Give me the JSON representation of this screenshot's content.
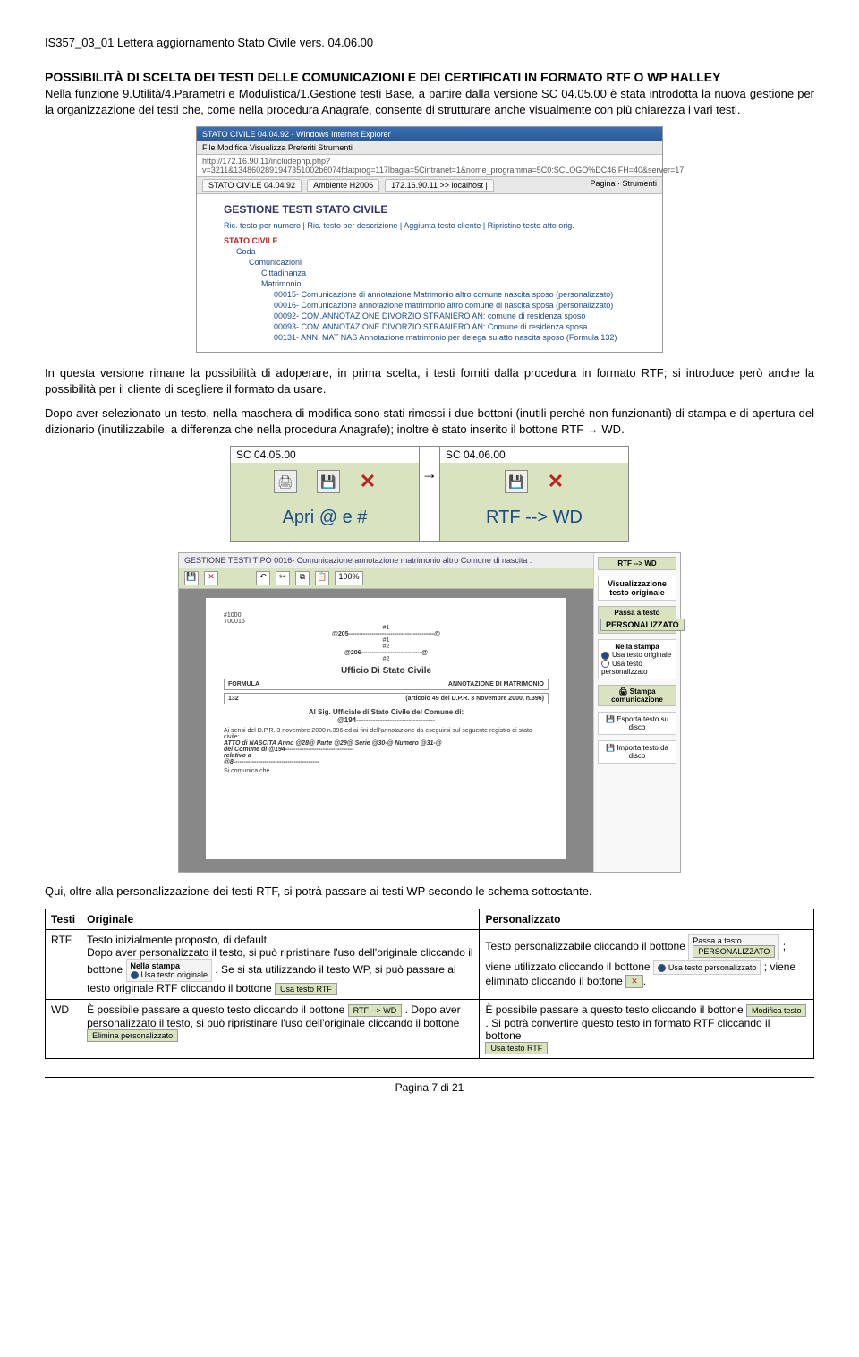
{
  "header": "IS357_03_01 Lettera aggiornamento Stato Civile vers. 04.06.00",
  "title_line1": "POSSIBILITÀ DI SCELTA DEI TESTI DELLE COMUNICAZIONI E DEI CERTIFICATI IN FORMATO RTF O WP HALLEY",
  "intro": "Nella funzione 9.Utilità/4.Parametri e Modulistica/1.Gestione testi Base, a partire dalla versione SC 04.05.00 è stata introdotta la nuova gestione per la organizzazione dei testi che, come nella procedura Anagrafe, consente di strutturare anche visualmente con più chiarezza i vari testi.",
  "ss1": {
    "title": "STATO CIVILE 04.04.92 - Windows Internet Explorer",
    "menu": "File   Modifica   Visualizza   Preferiti   Strumenti",
    "addr": "http://172.16.90.11/includephp.php?v=3211&1348602891947351002b6074fdatprog=117lbagia=5Cintranet=1&nome_programma=5C0:SCLOGO%DC46IFH=40&server=17",
    "tabs": [
      "STATO CIVILE 04.04.92",
      "Ambiente H2006",
      "172.16.90.11 >> localhost |"
    ],
    "tabright": "Pagina  ·  Strumenti",
    "heading": "GESTIONE TESTI STATO CIVILE",
    "links": "Ric. testo per numero | Ric. testo per descrizione | Aggiunta testo cliente | Ripristino testo atto orig.",
    "tree": {
      "root": "STATO CIVILE",
      "l1": "Coda",
      "l2_1": "Comunicazioni",
      "l3_1": "Cittadinanza",
      "l3_2": "Matrimonio",
      "l4_1": "00015- Comunicazione di annotazione Matrimonio altro comune nascita sposo (personalizzato)",
      "l4_2": "00016- Comunicazione annotazione matrimonio altro comune di nascita sposa (personalizzato)",
      "l4_3": "00092- COM.ANNOTAZIONE DIVORZIO STRANIERO AN: comune di residenza sposo",
      "l4_4": "00093- COM.ANNOTAZIONE DIVORZIO STRANIERO AN: Comune di residenza sposa",
      "l4_5": "00131- ANN. MAT NAS Annotazione matrimonio per delega su atto nascita sposo (Formula 132)"
    }
  },
  "para2": "In questa versione rimane la possibilità di adoperare, in prima scelta, i testi forniti dalla procedura in formato RTF; si introduce però anche la possibilità per il cliente di scegliere il formato da usare.",
  "para3": "Dopo aver selezionato un testo, nella maschera di modifica sono stati rimossi i due bottoni (inutili perché non funzionanti) di stampa e di apertura del dizionario (inutilizzabile, a differenza che nella procedura Anagrafe); inoltre è stato inserito il bottone RTF → WD.",
  "toolbar": {
    "head_left": "SC 04.05.00",
    "head_right": "SC 04.06.00",
    "arrow": "→",
    "label_left": "Apri @ e #",
    "label_right": "RTF --> WD"
  },
  "editor": {
    "title": "GESTIONE TESTI TIPO 0016- Comunicazione annotazione matrimonio altro Comune di nascita :",
    "zoom": "100%",
    "doc": {
      "l1": "#1000",
      "l2": "T00016",
      "l3": "#1",
      "l4": "@205-----------------------------------------@",
      "l5": "#1",
      "l6": "#2",
      "l7": "@206-----------------------------@",
      "l8": "#2",
      "heading": "Ufficio Di Stato Civile",
      "formula_label": "FORMULA",
      "formula_text": "ANNOTAZIONE DI MATRIMONIO",
      "num": "132",
      "num_text": "(articolo 49 del D.P.R. 3 Novembre 2000, n.396)",
      "dest": "Al Sig. Ufficiale di Stato Civile del Comune di:",
      "dest2": "@194---------------------------------",
      "body1": "Ai sensi del D.P.R. 3 novembre 2000 n.396 ed ai fini dell'annotazione da eseguirsi sul seguente registro di stato civile:",
      "body2": "ATTO di NASCITA Anno @28@ Parte @29@ Serie @30-@ Numero @31-@",
      "body3": "del Comune di @194---------------------------------",
      "body4": "relativo a",
      "body5": "@8-----------------------------------------",
      "body6": "Si comunica che"
    },
    "right": {
      "btn_rtf": "RTF --> WD",
      "vis_head": "Visualizzazione testo originale",
      "passa_head": "Passa a testo",
      "passa_btn": "PERSONALIZZATO",
      "stampa_head": "Nella stampa",
      "radio1": "Usa testo originale",
      "radio2": "Usa testo personalizzato",
      "stampa_btn": "Stampa comunicazione",
      "esporta": "Esporta testo su disco",
      "importa": "Importa testo da disco"
    }
  },
  "para4": "Qui, oltre alla personalizzazione dei testi RTF, si potrà passare ai testi WP secondo le schema sottostante.",
  "table": {
    "h1": "Testi",
    "h2": "Originale",
    "h3": "Personalizzato",
    "r1c1": "RTF",
    "r1c2_a": "Testo inizialmente proposto, di default.",
    "r1c2_b": "Dopo aver personalizzato il testo, si può ripristinare l'uso dell'originale cliccando il bottone ",
    "r1c2_c": ". Se si sta utilizzando il testo WP, si può passare al testo  originale RTF  cliccando il bottone ",
    "r1c3_a": "Testo personalizzabile cliccando il bottone ",
    "r1c3_b": "; viene utilizzato cliccando il bottone ",
    "r1c3_c": "; viene eliminato cliccando il bottone ",
    "r2c1": "WD",
    "r2c2_a": "È possibile passare a questo testo cliccando il bottone ",
    "r2c2_b": ". Dopo aver personalizzato il testo, si può ripristinare l'uso dell'originale cliccando il bottone",
    "r2c3_a": "È possibile passare a questo testo cliccando il bottone ",
    "r2c3_b": ". Si potrà convertire questo testo in formato RTF cliccando il bottone",
    "btns": {
      "nella_stampa_head": "Nella stampa",
      "usa_orig": "Usa testo originale",
      "usa_rtf": "Usa testo RTF",
      "passa_head": "Passa a testo",
      "personalizzato": "PERSONALIZZATO",
      "usa_pers": "Usa testo personalizzato",
      "delete": "✕",
      "rtf_wd": "RTF --> WD",
      "modifica": "Modifica testo",
      "elimina": "Elimina personalizzato"
    }
  },
  "footer": "Pagina 7 di 21"
}
